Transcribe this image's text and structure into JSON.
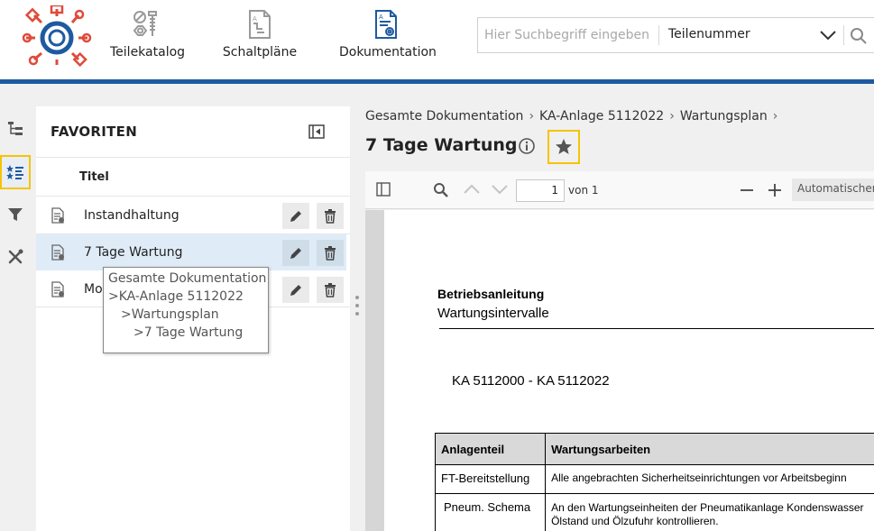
{
  "topnav": {
    "items": [
      {
        "label": "Teilekatalog",
        "icon": "parts-catalog-icon"
      },
      {
        "label": "Schaltpläne",
        "icon": "schematic-icon"
      },
      {
        "label": "Dokumentation",
        "icon": "documentation-icon"
      }
    ],
    "active_index": 2
  },
  "search": {
    "placeholder": "Hier Suchbegriff eingeben",
    "value": "",
    "type_selected": "Teilenummer"
  },
  "rail": {
    "items": [
      {
        "icon": "tree-structure-icon",
        "active": false
      },
      {
        "icon": "favorites-list-icon",
        "active": true
      },
      {
        "icon": "filter-icon",
        "active": false
      },
      {
        "icon": "tools-icon",
        "active": false
      }
    ]
  },
  "favorites": {
    "title": "FAVORITEN",
    "column_title": "Titel",
    "items": [
      {
        "name": "Instandhaltung",
        "selected": false
      },
      {
        "name": "7 Tage Wartung",
        "selected": true
      },
      {
        "name": "Mo",
        "selected": false
      }
    ],
    "tooltip": [
      "Gesamte Dokumentation",
      ">KA-Anlage 5112022",
      ">Wartungsplan",
      ">7 Tage Wartung"
    ]
  },
  "breadcrumb": [
    "Gesamte Dokumentation",
    "KA-Anlage 5112022",
    "Wartungsplan"
  ],
  "document": {
    "title": "7 Tage Wartung"
  },
  "viewer": {
    "page_current": "1",
    "page_of": "von 1",
    "zoom": "Automatischer Zoom"
  },
  "pdf": {
    "heading": "Betriebsanleitung",
    "subheading": "Wartungsintervalle",
    "model_range": "KA 5112000 - KA 5112022",
    "table": {
      "headers": [
        "Anlagenteil",
        "Wartungsarbeiten"
      ],
      "rows": [
        {
          "part": "FT-Bereitstellung",
          "work": [
            "Alle angebrachten Sicherheitseinrichtungen vor Arbeitsbeginn"
          ]
        },
        {
          "part": "Pneum. Schema",
          "work": [
            "An den Wartungseinheiten der Pneumatikanlage Kondenswasser",
            "Ölstand und Ölzufuhr kontrollieren."
          ]
        }
      ]
    }
  },
  "colors": {
    "brand_blue": "#1e5aa0",
    "brand_red": "#e04a3a",
    "highlight_yellow": "#f5c400",
    "selected_row": "#dfecf8"
  }
}
